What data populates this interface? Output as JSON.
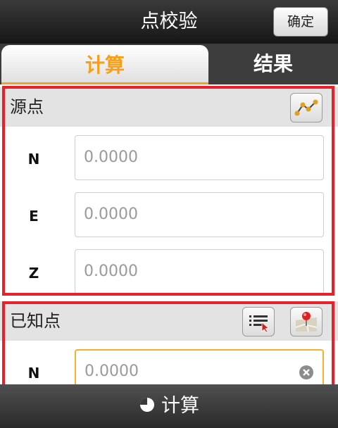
{
  "header": {
    "title": "点校验",
    "confirm_label": "确定"
  },
  "tabs": [
    {
      "label": "计算",
      "active": true
    },
    {
      "label": "结果",
      "active": false
    }
  ],
  "source_point": {
    "title": "源点",
    "fields": [
      {
        "label": "N",
        "placeholder": "0.0000"
      },
      {
        "label": "E",
        "placeholder": "0.0000"
      },
      {
        "label": "Z",
        "placeholder": "0.0000"
      }
    ]
  },
  "known_point": {
    "title": "已知点",
    "fields": [
      {
        "label": "N",
        "placeholder": "0.0000"
      }
    ]
  },
  "footer": {
    "calc_label": "计算"
  },
  "colors": {
    "accent": "#f4a01c",
    "highlight_frame": "#e8202a",
    "focus_border": "#f4b030"
  },
  "icons": {
    "source_action": "chart-line-icon",
    "known_list": "list-select-icon",
    "known_map": "map-pin-icon",
    "field_clear": "clear-icon",
    "calc": "pie-chart-icon"
  }
}
